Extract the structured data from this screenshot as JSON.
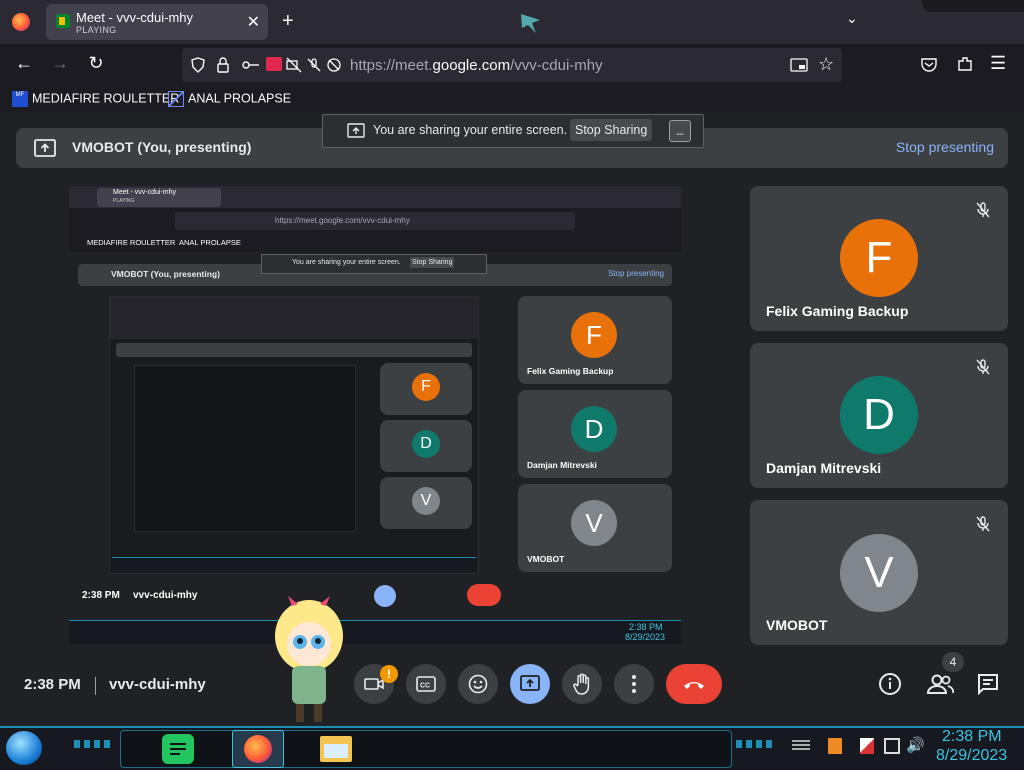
{
  "browser": {
    "tab": {
      "title": "Meet - vvv-cdui-mhy",
      "subtitle": "PLAYING"
    },
    "url": {
      "prefix": "https://meet.",
      "domain": "google.com",
      "path": "/vvv-cdui-mhy"
    },
    "bookmarks": [
      {
        "label": "MEDIAFIRE ROULETTER"
      },
      {
        "label": "ANAL PROLAPSE"
      }
    ]
  },
  "share_banner": {
    "text": "You are sharing your entire screen.",
    "stop_label": "Stop Sharing",
    "minimize_label": "_"
  },
  "presenting": {
    "label": "VMOBOT (You, presenting)",
    "stop_label": "Stop presenting"
  },
  "participants": [
    {
      "name": "Felix Gaming Backup",
      "initial": "F",
      "color": "#e8710a"
    },
    {
      "name": "Damjan Mitrevski",
      "initial": "D",
      "color": "#0f7a6b"
    },
    {
      "name": "VMOBOT",
      "initial": "V",
      "color": "#80868b"
    }
  ],
  "bottom": {
    "time": "2:38 PM",
    "meeting_code": "vvv-cdui-mhy",
    "people_count": "4",
    "notification": "!"
  },
  "colors": {
    "end_call": "#ea4335",
    "present_active": "#8ab4f8",
    "link_blue": "#8ab4f8"
  },
  "taskbar": {
    "time": "2:38 PM",
    "date": "8/29/2023"
  },
  "nested_share": {
    "tab_title": "Meet - vvv-cdui-mhy",
    "tab_subtitle": "PLAYING",
    "url": "https://meet.google.com/vvv-cdui-mhy",
    "bm1": "MEDIAFIRE ROULETTER",
    "bm2": "ANAL PROLAPSE",
    "presenting": "VMOBOT (You, presenting)",
    "share_text": "You are sharing your entire screen.",
    "stop_sharing": "Stop Sharing",
    "stop_presenting": "Stop presenting",
    "time": "2:38 PM",
    "code": "vvv-cdui-mhy",
    "tb_time": "2:38 PM",
    "tb_date": "8/29/2023"
  }
}
